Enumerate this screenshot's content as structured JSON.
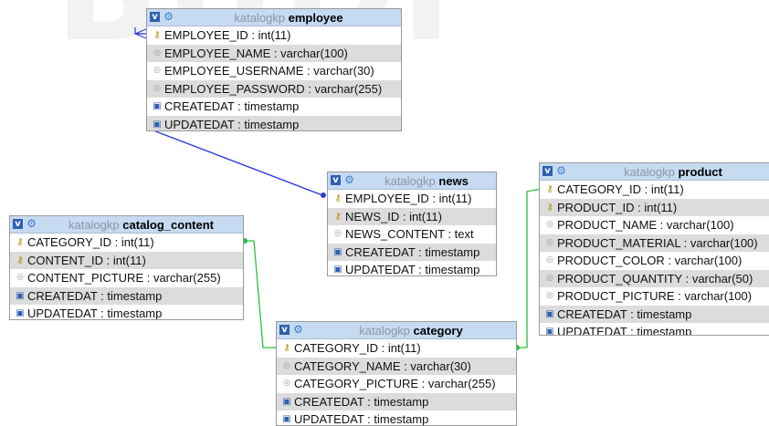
{
  "diagram": {
    "watermark": "BUDI",
    "colors": {
      "header_bg": "#c6daf2",
      "employee_news_link": "#2b3bd6",
      "category_links": "#27c23b"
    },
    "tables": [
      {
        "id": "employee",
        "db": "katalogkp",
        "name": "employee",
        "columns": [
          {
            "text": "EMPLOYEE_ID : int(11)",
            "icon": "key-icon"
          },
          {
            "text": "EMPLOYEE_NAME : varchar(100)",
            "icon": "column-icon"
          },
          {
            "text": "EMPLOYEE_USERNAME : varchar(30)",
            "icon": "column-icon"
          },
          {
            "text": "EMPLOYEE_PASSWORD : varchar(255)",
            "icon": "column-icon"
          },
          {
            "text": "CREATEDAT : timestamp",
            "icon": "timestamp-icon"
          },
          {
            "text": "UPDATEDAT : timestamp",
            "icon": "timestamp-icon"
          }
        ]
      },
      {
        "id": "news",
        "db": "katalogkp",
        "name": "news",
        "columns": [
          {
            "text": "EMPLOYEE_ID : int(11)",
            "icon": "key-icon"
          },
          {
            "text": "NEWS_ID : int(11)",
            "icon": "key-icon"
          },
          {
            "text": "NEWS_CONTENT : text",
            "icon": "column-icon"
          },
          {
            "text": "CREATEDAT : timestamp",
            "icon": "timestamp-icon"
          },
          {
            "text": "UPDATEDAT : timestamp",
            "icon": "timestamp-icon"
          }
        ]
      },
      {
        "id": "product",
        "db": "katalogkp",
        "name": "product",
        "columns": [
          {
            "text": "CATEGORY_ID : int(11)",
            "icon": "key-icon"
          },
          {
            "text": "PRODUCT_ID : int(11)",
            "icon": "key-icon"
          },
          {
            "text": "PRODUCT_NAME : varchar(100)",
            "icon": "column-icon"
          },
          {
            "text": "PRODUCT_MATERIAL : varchar(100)",
            "icon": "column-icon"
          },
          {
            "text": "PRODUCT_COLOR : varchar(100)",
            "icon": "column-icon"
          },
          {
            "text": "PRODUCT_QUANTITY : varchar(50)",
            "icon": "column-icon"
          },
          {
            "text": "PRODUCT_PICTURE : varchar(100)",
            "icon": "column-icon"
          },
          {
            "text": "CREATEDAT : timestamp",
            "icon": "timestamp-icon"
          },
          {
            "text": "UPDATEDAT : timestamp",
            "icon": "timestamp-icon"
          }
        ]
      },
      {
        "id": "catalog_content",
        "db": "katalogkp",
        "name": "catalog_content",
        "columns": [
          {
            "text": "CATEGORY_ID : int(11)",
            "icon": "key-icon"
          },
          {
            "text": "CONTENT_ID : int(11)",
            "icon": "key-icon"
          },
          {
            "text": "CONTENT_PICTURE : varchar(255)",
            "icon": "column-icon"
          },
          {
            "text": "CREATEDAT : timestamp",
            "icon": "timestamp-icon"
          },
          {
            "text": "UPDATEDAT : timestamp",
            "icon": "timestamp-icon"
          }
        ]
      },
      {
        "id": "category",
        "db": "katalogkp",
        "name": "category",
        "columns": [
          {
            "text": "CATEGORY_ID : int(11)",
            "icon": "key-icon"
          },
          {
            "text": "CATEGORY_NAME : varchar(30)",
            "icon": "column-icon"
          },
          {
            "text": "CATEGORY_PICTURE : varchar(255)",
            "icon": "column-icon"
          },
          {
            "text": "CREATEDAT : timestamp",
            "icon": "timestamp-icon"
          },
          {
            "text": "UPDATEDAT : timestamp",
            "icon": "timestamp-icon"
          }
        ]
      }
    ],
    "relations": [
      {
        "from": "employee.EMPLOYEE_ID",
        "to": "news.EMPLOYEE_ID",
        "color": "#2b3bd6"
      },
      {
        "from": "category.CATEGORY_ID",
        "to": "catalog_content.CATEGORY_ID",
        "color": "#27c23b"
      },
      {
        "from": "category.CATEGORY_ID",
        "to": "product.CATEGORY_ID",
        "color": "#27c23b"
      }
    ]
  }
}
